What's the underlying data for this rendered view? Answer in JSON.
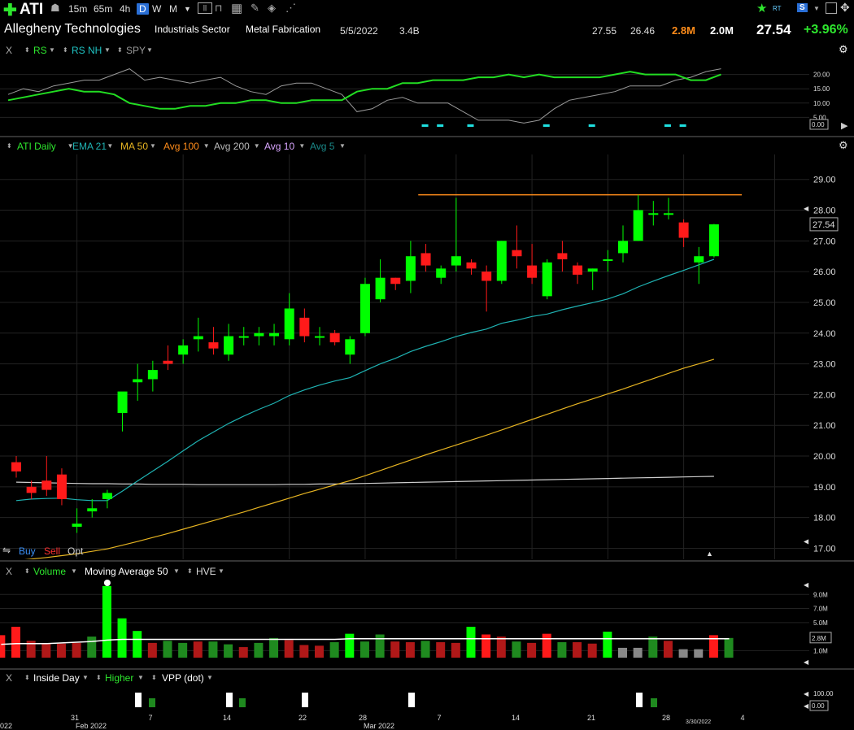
{
  "toolbar": {
    "symbol": "ATI",
    "intervals": [
      "15m",
      "65m",
      "4h",
      "D",
      "W",
      "M"
    ],
    "active_interval": "D"
  },
  "info": {
    "company": "Allegheny Technologies",
    "sector": "Industrials Sector",
    "industry": "Metal Fabrication",
    "date": "5/5/2022",
    "market_cap": "3.4B",
    "high": "27.55",
    "low": "26.46",
    "volume": "2.8M",
    "avg_volume": "2.0M",
    "last": "27.54",
    "change_pct": "+3.96%",
    "rt_label": "RT",
    "s_label": "S"
  },
  "rs_pane": {
    "close": "X",
    "items": [
      "RS",
      "RS NH",
      "SPY"
    ],
    "scale": [
      "20.00",
      "15.00",
      "10.00",
      "5.00"
    ],
    "readout": "0.00"
  },
  "price_pane": {
    "items": [
      "ATI Daily",
      "EMA 21",
      "MA 50",
      "Avg 100",
      "Avg 200",
      "Avg 10",
      "Avg 5"
    ],
    "item_colors": [
      "#2ee62e",
      "#1fb3b3",
      "#e6b422",
      "#ff8c1a",
      "#bbbbbb",
      "#d9a6ff",
      "#1a8a8a"
    ],
    "readout": "27.54",
    "buy": "Buy",
    "sell": "Sell",
    "opt": "Opt"
  },
  "volume_pane": {
    "close": "X",
    "items": [
      "Volume",
      "Moving Average 50",
      "HVE"
    ],
    "scale": [
      "9.0M",
      "7.0M",
      "5.0M",
      "1.0M"
    ],
    "readout": "2.8M"
  },
  "inside_pane": {
    "close": "X",
    "items": [
      "Inside Day",
      "Higher",
      "VPP (dot)"
    ],
    "scale": "100.00",
    "readout": "0.00"
  },
  "x_axis": {
    "ticks": [
      "31",
      "7",
      "14",
      "22",
      "28",
      "7",
      "14",
      "21",
      "28",
      "4"
    ],
    "months": [
      "Feb 2022",
      "Mar 2022"
    ],
    "edge_left": "022",
    "cursor_date": "3/30/2022"
  },
  "chart_data": {
    "type": "candlestick",
    "ylim": [
      16.8,
      29.6
    ],
    "y_ticks": [
      17,
      18,
      19,
      20,
      21,
      22,
      23,
      24,
      25,
      26,
      27,
      28,
      29
    ],
    "resistance_level": 28.5,
    "candles": [
      {
        "o": 19.8,
        "h": 20.0,
        "l": 19.3,
        "c": 19.5
      },
      {
        "o": 19.0,
        "h": 19.2,
        "l": 18.6,
        "c": 18.8
      },
      {
        "o": 19.2,
        "h": 20.0,
        "l": 18.7,
        "c": 18.9
      },
      {
        "o": 19.4,
        "h": 19.6,
        "l": 18.4,
        "c": 18.6
      },
      {
        "o": 17.7,
        "h": 18.3,
        "l": 17.5,
        "c": 17.8
      },
      {
        "o": 18.2,
        "h": 18.6,
        "l": 18.0,
        "c": 18.3
      },
      {
        "o": 18.6,
        "h": 18.9,
        "l": 18.3,
        "c": 18.8
      },
      {
        "o": 21.4,
        "h": 21.9,
        "l": 20.8,
        "c": 22.1
      },
      {
        "o": 22.4,
        "h": 23.0,
        "l": 21.8,
        "c": 22.5
      },
      {
        "o": 22.5,
        "h": 23.1,
        "l": 22.1,
        "c": 22.8
      },
      {
        "o": 23.1,
        "h": 23.6,
        "l": 22.8,
        "c": 23.0
      },
      {
        "o": 23.3,
        "h": 23.8,
        "l": 23.0,
        "c": 23.6
      },
      {
        "o": 23.8,
        "h": 24.5,
        "l": 23.4,
        "c": 23.9
      },
      {
        "o": 23.7,
        "h": 24.2,
        "l": 23.3,
        "c": 23.5
      },
      {
        "o": 23.3,
        "h": 24.3,
        "l": 23.1,
        "c": 23.9
      },
      {
        "o": 23.9,
        "h": 24.2,
        "l": 23.6,
        "c": 23.9
      },
      {
        "o": 23.9,
        "h": 24.2,
        "l": 23.6,
        "c": 24.0
      },
      {
        "o": 23.9,
        "h": 24.3,
        "l": 23.6,
        "c": 24.0
      },
      {
        "o": 23.8,
        "h": 25.3,
        "l": 23.6,
        "c": 24.8
      },
      {
        "o": 24.5,
        "h": 24.8,
        "l": 23.7,
        "c": 23.9
      },
      {
        "o": 23.9,
        "h": 24.2,
        "l": 23.6,
        "c": 23.9
      },
      {
        "o": 24.0,
        "h": 24.1,
        "l": 23.6,
        "c": 23.7
      },
      {
        "o": 23.3,
        "h": 23.9,
        "l": 23.0,
        "c": 23.8
      },
      {
        "o": 24.0,
        "h": 25.8,
        "l": 23.9,
        "c": 25.6
      },
      {
        "o": 25.1,
        "h": 26.4,
        "l": 25.0,
        "c": 25.8
      },
      {
        "o": 25.8,
        "h": 25.8,
        "l": 25.4,
        "c": 25.6
      },
      {
        "o": 25.7,
        "h": 27.0,
        "l": 25.3,
        "c": 26.5
      },
      {
        "o": 26.6,
        "h": 26.9,
        "l": 26.0,
        "c": 26.2
      },
      {
        "o": 25.8,
        "h": 26.2,
        "l": 25.6,
        "c": 26.1
      },
      {
        "o": 26.2,
        "h": 28.4,
        "l": 26.0,
        "c": 26.5
      },
      {
        "o": 26.3,
        "h": 26.4,
        "l": 25.9,
        "c": 26.1
      },
      {
        "o": 26.0,
        "h": 26.2,
        "l": 24.7,
        "c": 25.7
      },
      {
        "o": 25.7,
        "h": 27.0,
        "l": 25.6,
        "c": 27.0
      },
      {
        "o": 26.7,
        "h": 27.5,
        "l": 26.1,
        "c": 26.5
      },
      {
        "o": 26.2,
        "h": 26.9,
        "l": 25.6,
        "c": 25.8
      },
      {
        "o": 25.2,
        "h": 26.4,
        "l": 25.1,
        "c": 26.3
      },
      {
        "o": 26.6,
        "h": 27.0,
        "l": 26.0,
        "c": 26.4
      },
      {
        "o": 26.2,
        "h": 26.3,
        "l": 25.6,
        "c": 25.9
      },
      {
        "o": 26.0,
        "h": 26.1,
        "l": 25.4,
        "c": 26.1
      },
      {
        "o": 26.4,
        "h": 26.7,
        "l": 26.0,
        "c": 26.4
      },
      {
        "o": 26.6,
        "h": 27.5,
        "l": 26.3,
        "c": 27.0
      },
      {
        "o": 27.0,
        "h": 28.5,
        "l": 27.0,
        "c": 28.0
      },
      {
        "o": 27.9,
        "h": 28.3,
        "l": 27.5,
        "c": 27.9
      },
      {
        "o": 27.9,
        "h": 28.4,
        "l": 27.7,
        "c": 27.9
      },
      {
        "o": 27.6,
        "h": 27.7,
        "l": 26.8,
        "c": 27.1
      },
      {
        "o": 26.3,
        "h": 26.8,
        "l": 25.6,
        "c": 26.5
      },
      {
        "o": 26.5,
        "h": 27.55,
        "l": 26.46,
        "c": 27.54
      }
    ],
    "ema21": [
      18.55,
      18.6,
      18.62,
      18.63,
      18.58,
      18.55,
      18.55,
      18.86,
      19.19,
      19.51,
      19.83,
      20.17,
      20.5,
      20.78,
      21.06,
      21.3,
      21.52,
      21.72,
      21.97,
      22.15,
      22.31,
      22.44,
      22.55,
      22.78,
      23.0,
      23.18,
      23.4,
      23.57,
      23.72,
      23.89,
      24.02,
      24.13,
      24.32,
      24.42,
      24.54,
      24.62,
      24.76,
      24.88,
      24.99,
      25.11,
      25.28,
      25.5,
      25.69,
      25.87,
      26.04,
      26.22,
      26.4
    ],
    "ma50": [
      16.6,
      16.65,
      16.7,
      16.76,
      16.82,
      16.9,
      16.98,
      17.1,
      17.22,
      17.35,
      17.48,
      17.62,
      17.76,
      17.9,
      18.04,
      18.18,
      18.33,
      18.48,
      18.63,
      18.78,
      18.92,
      19.06,
      19.2,
      19.36,
      19.53,
      19.7,
      19.87,
      20.04,
      20.2,
      20.36,
      20.52,
      20.68,
      20.85,
      21.02,
      21.19,
      21.36,
      21.53,
      21.7,
      21.86,
      22.02,
      22.18,
      22.35,
      22.52,
      22.69,
      22.86,
      23.0,
      23.15
    ],
    "ma200": [
      19.15,
      19.14,
      19.13,
      19.12,
      19.11,
      19.1,
      19.1,
      19.09,
      19.09,
      19.08,
      19.08,
      19.08,
      19.07,
      19.07,
      19.07,
      19.07,
      19.07,
      19.07,
      19.08,
      19.08,
      19.09,
      19.09,
      19.1,
      19.11,
      19.12,
      19.13,
      19.14,
      19.15,
      19.16,
      19.17,
      19.18,
      19.19,
      19.2,
      19.21,
      19.22,
      19.23,
      19.24,
      19.25,
      19.26,
      19.27,
      19.28,
      19.29,
      19.3,
      19.31,
      19.32,
      19.33,
      19.34
    ],
    "volume": [
      {
        "v": 3.2,
        "up": false
      },
      {
        "v": 4.4,
        "up": false
      },
      {
        "v": 2.4,
        "up": false
      },
      {
        "v": 2.0,
        "up": false
      },
      {
        "v": 2.0,
        "up": false
      },
      {
        "v": 2.1,
        "up": false
      },
      {
        "v": 3.0,
        "up": true
      },
      {
        "v": 10.2,
        "up": true
      },
      {
        "v": 5.6,
        "up": true
      },
      {
        "v": 3.8,
        "up": true
      },
      {
        "v": 2.1,
        "up": false
      },
      {
        "v": 2.4,
        "up": true
      },
      {
        "v": 2.1,
        "up": true
      },
      {
        "v": 2.3,
        "up": false
      },
      {
        "v": 2.3,
        "up": true
      },
      {
        "v": 1.9,
        "up": true
      },
      {
        "v": 1.5,
        "up": false
      },
      {
        "v": 2.1,
        "up": true
      },
      {
        "v": 2.8,
        "up": true
      },
      {
        "v": 2.5,
        "up": false
      },
      {
        "v": 1.8,
        "up": false
      },
      {
        "v": 1.7,
        "up": false
      },
      {
        "v": 2.2,
        "up": true
      },
      {
        "v": 3.4,
        "up": true
      },
      {
        "v": 2.3,
        "up": true
      },
      {
        "v": 3.3,
        "up": true
      },
      {
        "v": 2.3,
        "up": false
      },
      {
        "v": 2.2,
        "up": false
      },
      {
        "v": 2.4,
        "up": true
      },
      {
        "v": 2.2,
        "up": false
      },
      {
        "v": 2.1,
        "up": false
      },
      {
        "v": 4.4,
        "up": true
      },
      {
        "v": 3.3,
        "up": false
      },
      {
        "v": 3.0,
        "up": false
      },
      {
        "v": 2.3,
        "up": true
      },
      {
        "v": 2.1,
        "up": false
      },
      {
        "v": 3.4,
        "up": false
      },
      {
        "v": 2.2,
        "up": true
      },
      {
        "v": 2.2,
        "up": false
      },
      {
        "v": 2.0,
        "up": false
      },
      {
        "v": 3.7,
        "up": true
      },
      {
        "v": 1.4,
        "up": null
      },
      {
        "v": 1.4,
        "up": null
      },
      {
        "v": 3.0,
        "up": true
      },
      {
        "v": 2.4,
        "up": false
      },
      {
        "v": 1.2,
        "up": null
      },
      {
        "v": 1.2,
        "up": null
      },
      {
        "v": 3.2,
        "up": false
      },
      {
        "v": 2.8,
        "up": true
      }
    ],
    "volume_ma50": [
      1.9,
      2.0,
      2.0,
      2.0,
      2.1,
      2.2,
      2.3,
      2.5,
      2.6,
      2.6,
      2.6,
      2.6,
      2.6,
      2.6,
      2.6,
      2.6,
      2.6,
      2.6,
      2.6,
      2.6,
      2.6,
      2.6,
      2.6,
      2.7,
      2.7,
      2.7,
      2.7,
      2.7,
      2.7,
      2.7,
      2.7,
      2.7,
      2.7,
      2.7,
      2.7,
      2.7,
      2.7,
      2.7,
      2.7,
      2.7,
      2.7,
      2.7,
      2.7,
      2.7,
      2.7,
      2.7,
      2.7,
      2.7,
      2.7
    ],
    "vol_ylim": [
      0,
      11
    ],
    "rs": [
      11,
      12,
      13,
      14,
      15,
      14,
      14,
      13,
      10,
      9,
      8,
      8,
      9,
      9,
      10,
      10,
      11,
      11,
      10,
      10,
      11,
      11,
      11,
      14,
      15,
      15,
      17,
      17,
      18,
      18,
      18,
      19,
      19,
      20,
      19,
      20,
      19,
      19,
      19,
      19,
      20,
      21,
      20,
      20,
      20,
      18,
      18,
      20
    ],
    "spy": [
      13,
      15,
      14,
      16,
      17,
      18,
      18,
      20,
      22,
      18,
      19,
      18,
      17,
      18,
      19,
      16,
      14,
      13,
      16,
      17,
      17,
      15,
      13,
      7,
      8,
      11,
      12,
      10,
      10,
      10,
      7,
      4,
      4,
      4,
      3,
      4,
      8,
      11,
      12,
      13,
      14,
      16,
      16,
      16,
      18,
      19,
      21,
      22
    ],
    "rs_ylim": [
      0,
      25
    ],
    "rs_nh_marks": [
      27,
      28,
      30,
      35,
      38,
      43,
      44
    ],
    "inside_day_marks": [
      10,
      16,
      21,
      28,
      46
    ],
    "higher_marks": [
      10,
      16,
      45
    ]
  }
}
